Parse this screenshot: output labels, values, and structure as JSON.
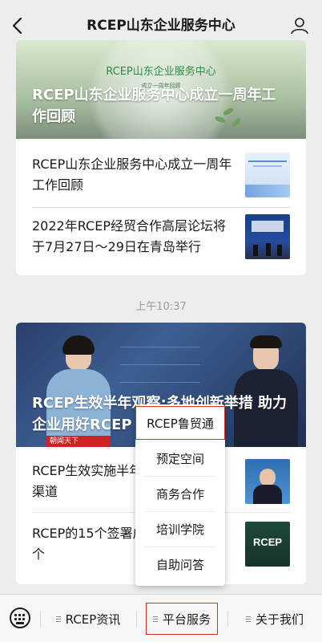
{
  "header": {
    "title": "RCEP山东企业服务中心"
  },
  "card1": {
    "hero_stamp": "RCEP山东企业服务中心",
    "hero_sub": "成立一周年回顾",
    "hero_title": "RCEP山东企业服务中心成立一周年工作回顾",
    "items": [
      {
        "text": "RCEP山东企业服务中心成立一周年工作回顾"
      },
      {
        "text": "2022年RCEP经贸合作高层论坛将于7月27日～29日在青岛举行"
      }
    ]
  },
  "time_divider": "上午10:37",
  "card2": {
    "hero_title": "RCEP生效半年观察:多地创新举措 助力企业用好RCEP",
    "ticker": "朝闻天下",
    "items": [
      {
        "text": "RCEP生效实施半年 拓市场、优化渠道"
      },
      {
        "text": "RCEP的15个签署成员数量已达13个"
      }
    ],
    "thumb2_text": "RCEP"
  },
  "popup_menu": {
    "items": [
      "RCEP鲁贸通",
      "预定空间",
      "商务合作",
      "培训学院",
      "自助问答"
    ],
    "highlighted": "RCEP鲁贸通"
  },
  "bottom_menu": {
    "tabs": [
      "RCEP资讯",
      "平台服务",
      "关于我们"
    ],
    "active": "平台服务"
  },
  "colors": {
    "highlight": "#d8301f"
  }
}
